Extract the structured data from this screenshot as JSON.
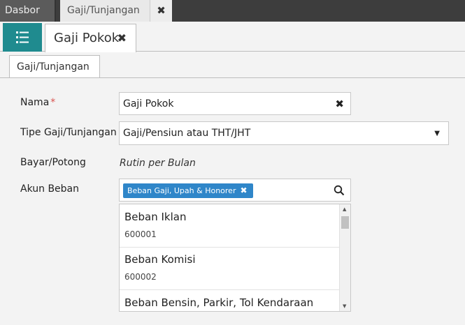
{
  "top_tabs": [
    {
      "label": "Dasbor"
    },
    {
      "label": "Gaji/Tunjangan"
    }
  ],
  "top_close_glyph": "✖",
  "menu_icon": "list-icon",
  "document_tab": {
    "label": "Gaji Pokok",
    "close_glyph": "✖"
  },
  "form_tab": {
    "label": "Gaji/Tunjangan"
  },
  "form": {
    "nama": {
      "label": "Nama",
      "required_mark": "*",
      "value": "Gaji Pokok",
      "clear_glyph": "✖"
    },
    "tipe": {
      "label": "Tipe Gaji/Tunjangan",
      "value": "Gaji/Pensiun atau THT/JHT",
      "arrow_glyph": "▼"
    },
    "bayar": {
      "label": "Bayar/Potong",
      "value": "Rutin per Bulan"
    },
    "akun": {
      "label": "Akun Beban",
      "chip": "Beban Gaji, Upah & Honorer",
      "chip_remove_glyph": "✖",
      "search_icon": "search-icon"
    }
  },
  "dropdown": {
    "options": [
      {
        "name": "Beban Iklan",
        "code": "600001"
      },
      {
        "name": "Beban Komisi",
        "code": "600002"
      },
      {
        "name": "Beban Bensin, Parkir, Tol Kendaraan",
        "code": ""
      }
    ]
  },
  "colors": {
    "accent_teal": "#1f8b8f",
    "chip_blue": "#2f86c9",
    "required_red": "#d9534f"
  }
}
